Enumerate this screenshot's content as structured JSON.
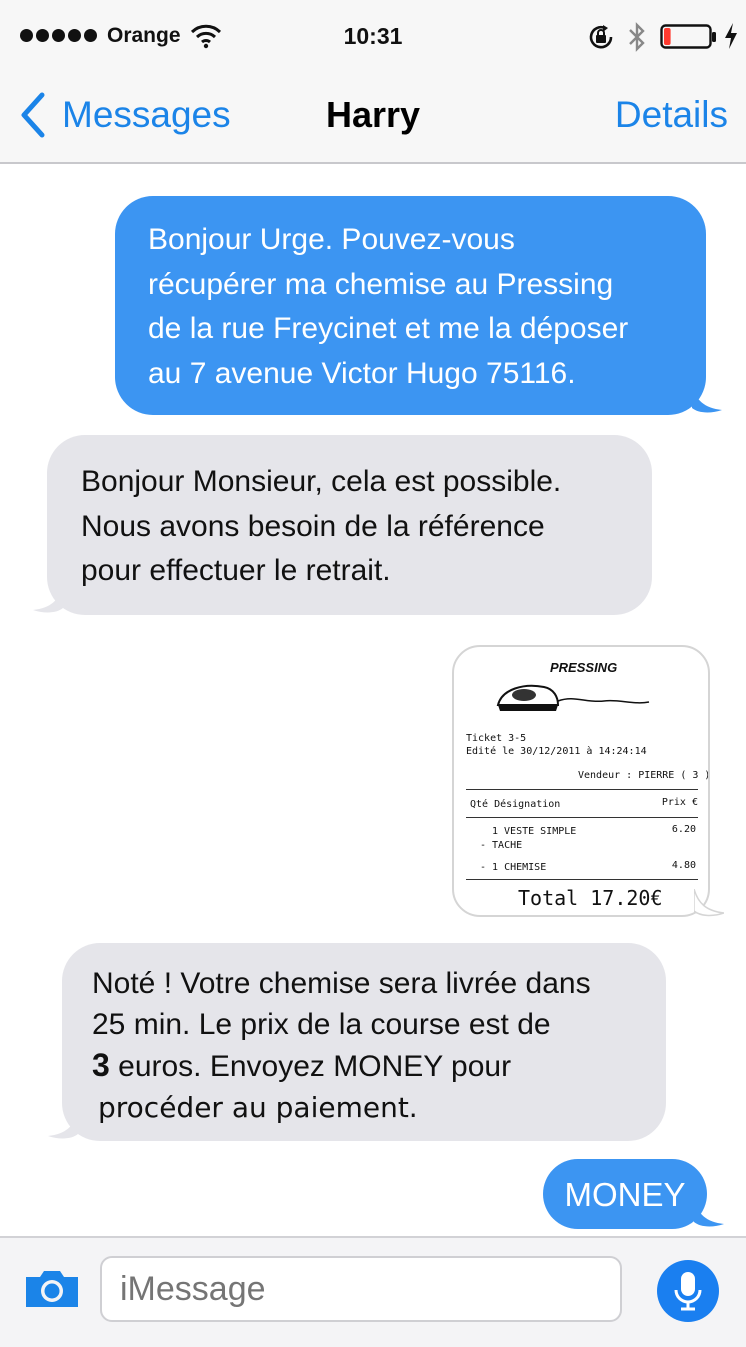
{
  "status_bar": {
    "carrier": "Orange",
    "time": "10:31",
    "signal_bars": 5,
    "battery_level": 0.15,
    "battery_color": "#ff3b30",
    "icons": [
      "wifi-icon",
      "rotation-lock-icon",
      "bluetooth-icon",
      "battery-icon",
      "charging-bolt-icon"
    ]
  },
  "nav": {
    "back_label": "Messages",
    "title": "Harry",
    "details_label": "Details"
  },
  "messages": [
    {
      "direction": "outgoing",
      "lines": [
        "Bonjour Urge. Pouvez-vous",
        "récupérer ma chemise au Pressing",
        "de la rue Freycinet et me la déposer",
        "au 7 avenue Victor Hugo 75116."
      ]
    },
    {
      "direction": "incoming",
      "lines": [
        "Bonjour Monsieur, cela est possible.",
        "Nous avons besoin de la référence",
        "pour effectuer le retrait."
      ]
    },
    {
      "direction": "outgoing",
      "type": "image",
      "receipt": {
        "shop": "PRESSING",
        "ticket": "Ticket 3-5",
        "edited": "Edité le 30/12/2011 à 14:24:14",
        "seller": "Vendeur : PIERRE ( 3 )",
        "col_left": "Qté Désignation",
        "col_right": "Prix €",
        "items": [
          {
            "line": "1 VESTE SIMPLE",
            "sub": "- TACHE",
            "price": "6.20"
          },
          {
            "line": "- 1 CHEMISE",
            "sub": "",
            "price": "4.80"
          }
        ],
        "total": "Total 17.20€"
      }
    },
    {
      "direction": "incoming",
      "lines": [
        "Noté ! Votre chemise sera livrée dans",
        "25 min. Le prix de la course est de"
      ],
      "line3_num": "3",
      "line3_rest": " euros. Envoyez MONEY pour",
      "line4": "procéder au paiement."
    },
    {
      "direction": "outgoing",
      "lines": [
        "MONEY"
      ]
    }
  ],
  "composer": {
    "placeholder": "iMessage"
  },
  "colors": {
    "outgoing_bubble": "#3c95f2",
    "incoming_bubble": "#e5e5ea",
    "accent": "#1b84e8"
  }
}
